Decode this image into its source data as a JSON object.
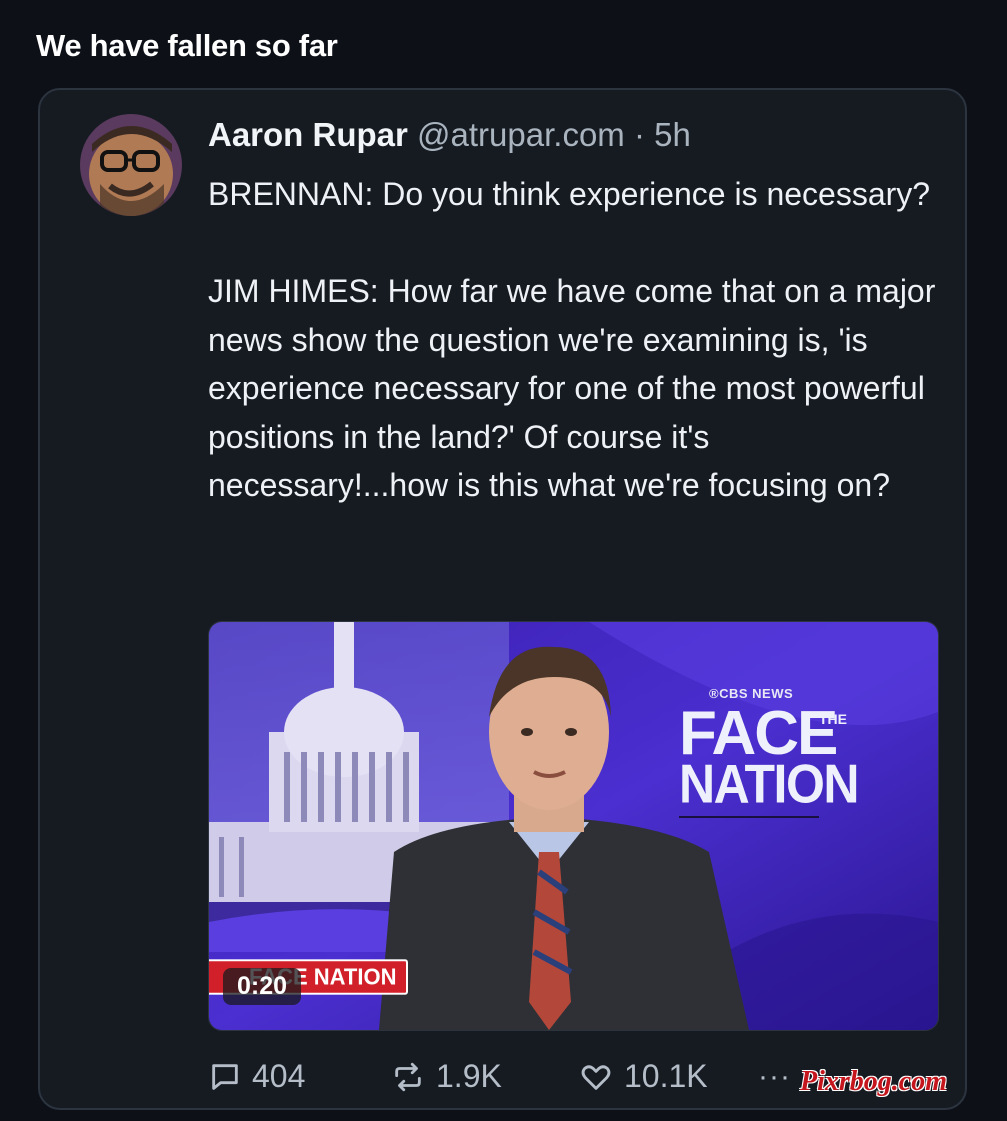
{
  "post": {
    "text": "We have fallen so far"
  },
  "quoted": {
    "author_name": "Aaron Rupar",
    "handle": "@atrupar.com",
    "separator": "·",
    "time": "5h",
    "paragraphs": [
      "BRENNAN: Do you think experience is necessary?",
      "JIM HIMES: How far we have come that on a major news show the question we're examining is, 'is experience necessary for one of the most powerful positions in the land?' Of course it's necessary!...how is this what we're focusing on?"
    ],
    "video": {
      "network": "®CBS NEWS",
      "show_word1": "FACE",
      "show_the": "THE",
      "show_word2": "NATION",
      "lower_third": "FACE NATION",
      "duration": "0:20"
    }
  },
  "actions": {
    "replies": "404",
    "reposts": "1.9K",
    "likes": "10.1K",
    "more": "···"
  },
  "watermark": "Pixrbog.com",
  "icons": [
    "reply-icon",
    "repost-icon",
    "like-icon",
    "more-icon"
  ],
  "colors": {
    "background": "#0d1117",
    "card": "#161b22",
    "text": "#e7ecf2",
    "muted": "#aab4bf"
  }
}
